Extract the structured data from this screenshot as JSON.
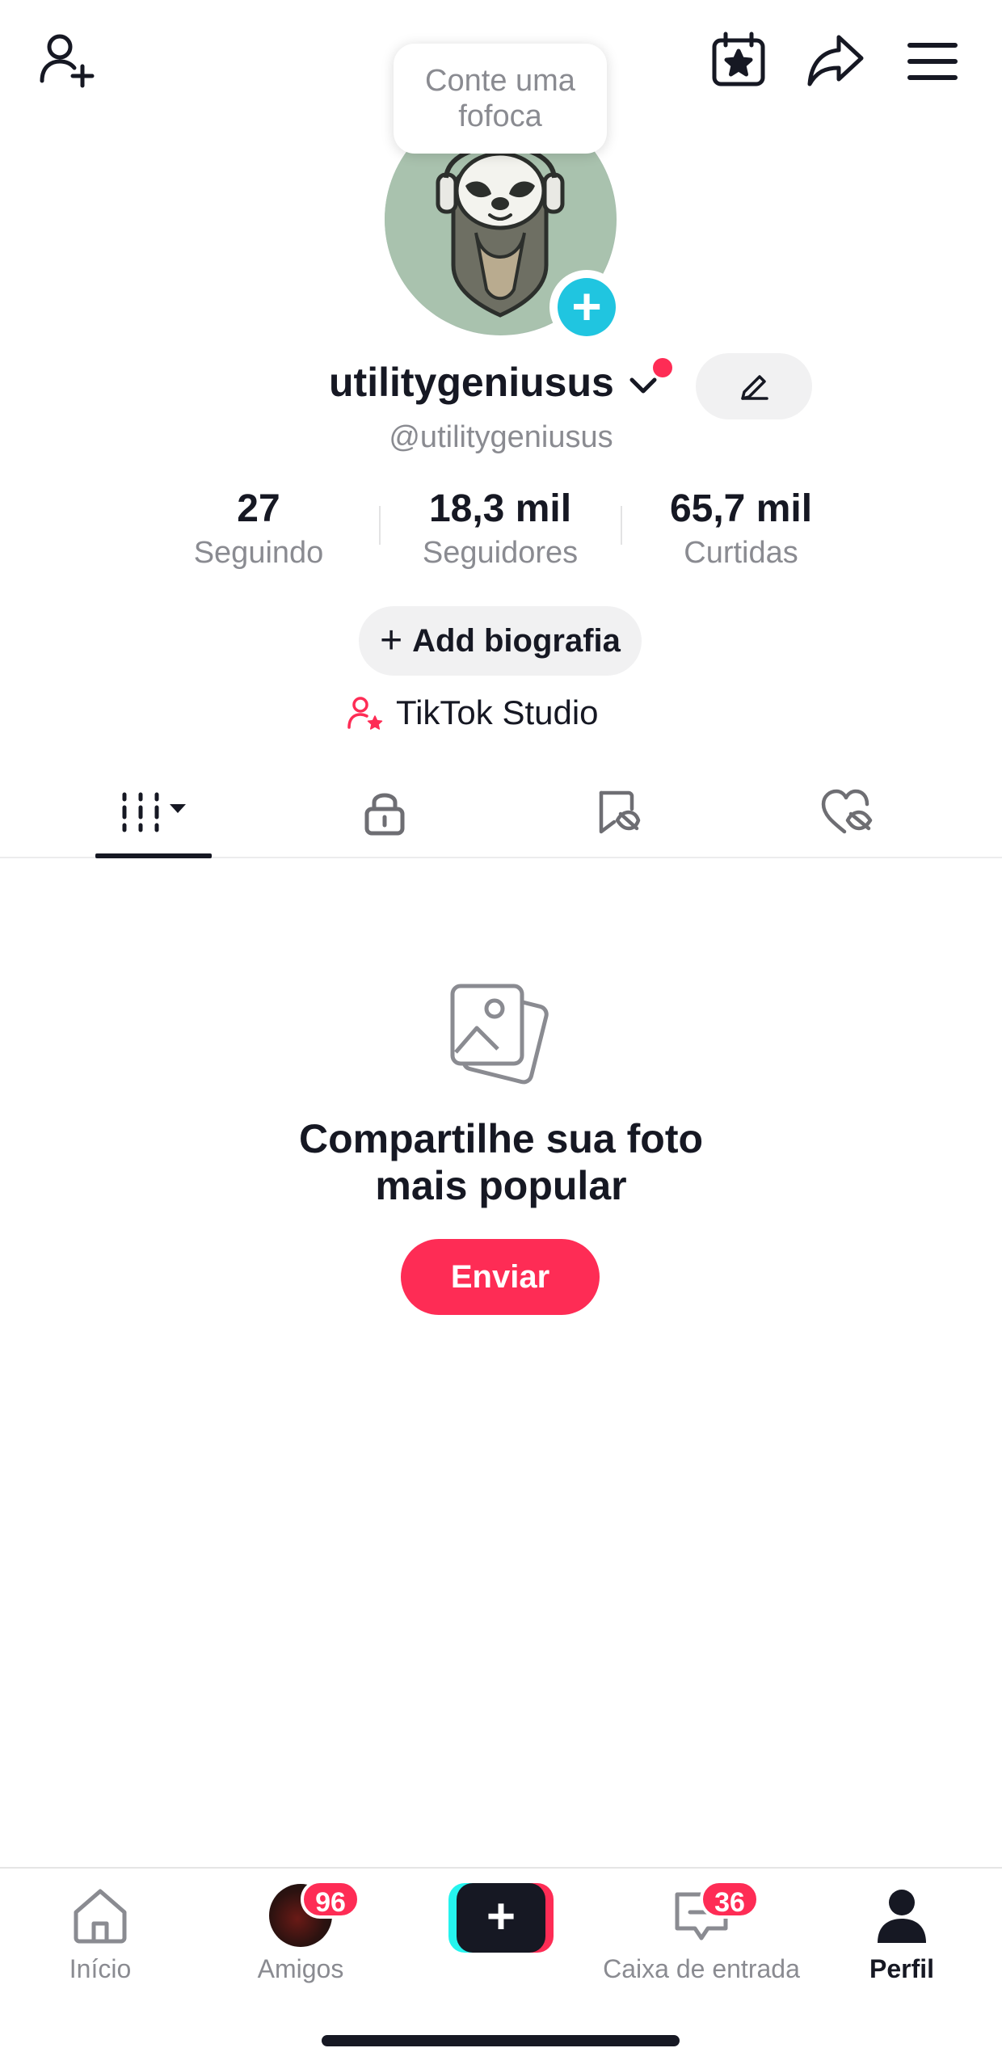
{
  "header": {
    "tooltip_line1": "Conte uma",
    "tooltip_line2": "fofoca"
  },
  "profile": {
    "username": "utilitygeniusus",
    "handle": "@utilitygeniusus",
    "has_notification_dot": true
  },
  "stats": [
    {
      "value": "27",
      "label": "Seguindo"
    },
    {
      "value": "18,3 mil",
      "label": "Seguidores"
    },
    {
      "value": "65,7 mil",
      "label": "Curtidas"
    }
  ],
  "actions": {
    "bio_plus": "+",
    "bio_label": "Add biografia",
    "studio_label": "TikTok Studio"
  },
  "tabs": [
    {
      "icon": "grid-icon",
      "active": true
    },
    {
      "icon": "lock-icon",
      "active": false
    },
    {
      "icon": "bookmark-hidden-icon",
      "active": false
    },
    {
      "icon": "heart-hidden-icon",
      "active": false
    }
  ],
  "empty_state": {
    "title_line1": "Compartilhe sua foto",
    "title_line2": "mais popular",
    "button_label": "Enviar"
  },
  "bottom_nav": {
    "home_label": "Início",
    "friends_label": "Amigos",
    "friends_badge": "96",
    "create_label": "+",
    "inbox_label": "Caixa de entrada",
    "inbox_badge": "36",
    "profile_label": "Perfil"
  },
  "colors": {
    "accent": "#fe2c55",
    "cyan": "#25f4ee",
    "plus_blue": "#20c5e0",
    "text": "#161823",
    "muted": "#8a8b91"
  }
}
